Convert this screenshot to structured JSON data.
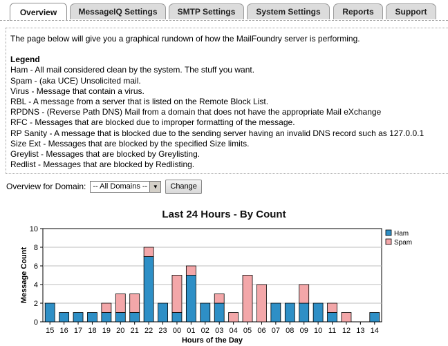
{
  "tabs": [
    {
      "label": "Overview",
      "active": true
    },
    {
      "label": "MessageIQ Settings",
      "active": false
    },
    {
      "label": "SMTP Settings",
      "active": false
    },
    {
      "label": "System Settings",
      "active": false
    },
    {
      "label": "Reports",
      "active": false
    },
    {
      "label": "Support",
      "active": false
    }
  ],
  "intro": "The page below will give you a graphical rundown of how the MailFoundry server is performing.",
  "legend": {
    "title": "Legend",
    "items": [
      "Ham - All mail considered clean by the system. The stuff you want.",
      "Spam - (aka UCE) Unsolicited mail.",
      "Virus - Message that contain a virus.",
      "RBL - A message from a server that is listed on the Remote Block List.",
      "RPDNS - (Reverse Path DNS) Mail from a domain that does not have the appropriate Mail eXchange",
      "RFC - Messages that are blocked due to improper formatting of the message.",
      "RP Sanity - A message that is blocked due to the sending server having an invalid DNS record such as 127.0.0.1",
      "Size Ext - Messages that are blocked by the specified Size limits.",
      "Greylist - Messages that are blocked by Greylisting.",
      "Redlist - Messages that are blocked by Redlisting."
    ]
  },
  "domain_filter": {
    "label": "Overview for Domain:",
    "selected": "-- All Domains --",
    "button": "Change"
  },
  "colors": {
    "ham": "#2e8fc6",
    "spam": "#f3a7a9"
  },
  "chart_data": {
    "type": "bar",
    "stacked": true,
    "title": "Last 24 Hours - By Count",
    "xlabel": "Hours of the Day",
    "ylabel": "Message Count",
    "ylim": [
      0,
      10
    ],
    "yticks": [
      0,
      2,
      4,
      6,
      8,
      10
    ],
    "grid": true,
    "legend_position": "top-right",
    "categories": [
      "15",
      "16",
      "17",
      "18",
      "19",
      "20",
      "21",
      "22",
      "23",
      "00",
      "01",
      "02",
      "03",
      "04",
      "05",
      "06",
      "07",
      "08",
      "09",
      "10",
      "11",
      "12",
      "13",
      "14"
    ],
    "series": [
      {
        "name": "Ham",
        "values": [
          2,
          1,
          1,
          1,
          1,
          1,
          1,
          7,
          2,
          1,
          5,
          2,
          2,
          0,
          0,
          0,
          2,
          2,
          2,
          2,
          1,
          0,
          0,
          1
        ]
      },
      {
        "name": "Spam",
        "values": [
          0,
          0,
          0,
          0,
          1,
          2,
          2,
          1,
          0,
          4,
          1,
          0,
          1,
          1,
          5,
          4,
          0,
          0,
          2,
          0,
          1,
          1,
          0,
          0
        ]
      }
    ]
  }
}
